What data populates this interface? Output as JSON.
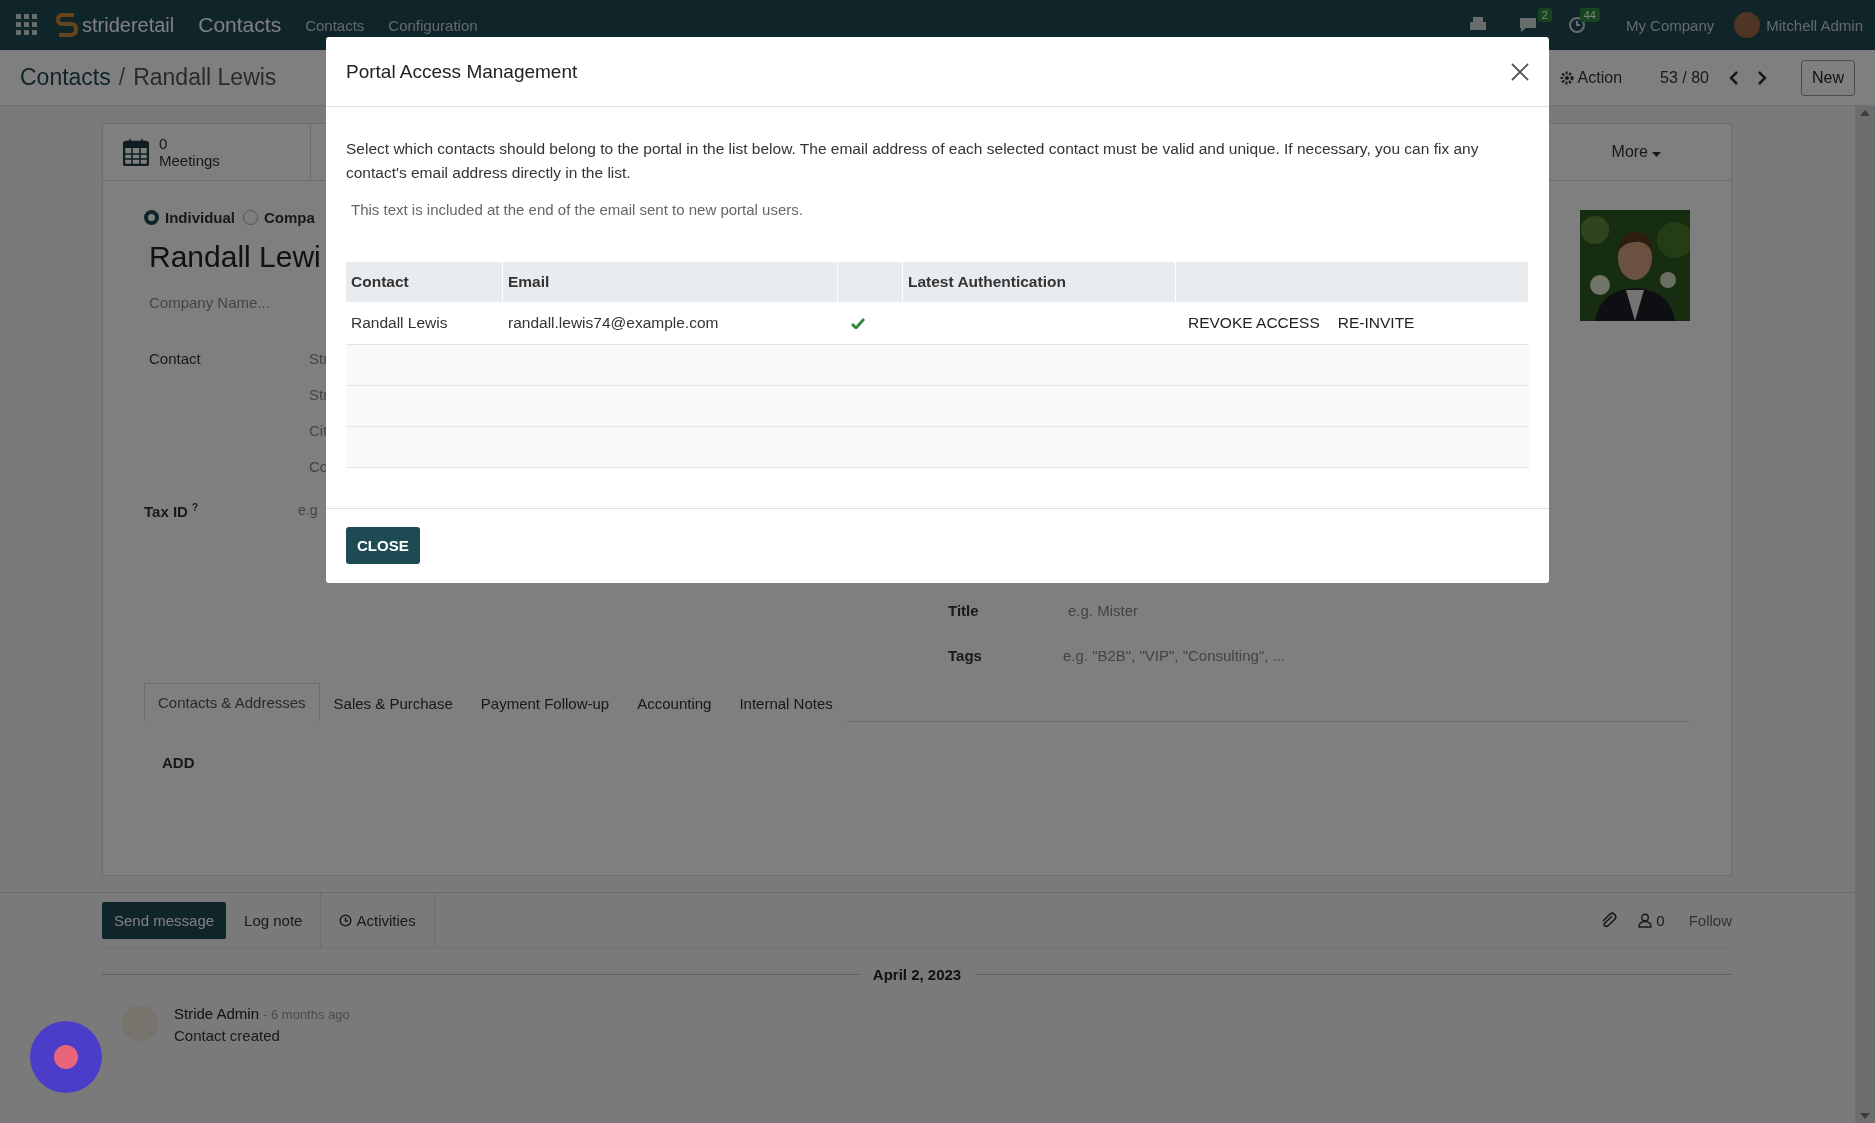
{
  "navbar": {
    "brand": "strideretail",
    "app_title": "Contacts",
    "menu": [
      "Contacts",
      "Configuration"
    ],
    "chat_count": "2",
    "activity_count": "44",
    "company": "My Company",
    "user": "Mitchell Admin"
  },
  "breadcrumb": {
    "parent": "Contacts",
    "separator": "/",
    "current": "Randall Lewis"
  },
  "pager": {
    "action": "Action",
    "position": "53 / 80",
    "new": "New"
  },
  "smart_buttons": [
    {
      "count": "0",
      "label": "Meetings"
    }
  ],
  "more": "More",
  "form": {
    "type_options": [
      {
        "label": "Individual",
        "selected": true
      },
      {
        "label": "Compa",
        "selected": false
      }
    ],
    "name": "Randall Lewi",
    "company": {
      "placeholder": "Company Name..."
    },
    "contact_label": "Contact",
    "address_fields": [
      {
        "placeholder": "Str"
      },
      {
        "placeholder": "Str"
      },
      {
        "placeholder": "Cit"
      },
      {
        "placeholder": "Co"
      }
    ],
    "tax_label": "Tax ID",
    "tax_hint": "?",
    "tax_field": {
      "placeholder": "e.g"
    },
    "title_label": "Title",
    "title_field": {
      "placeholder": "e.g. Mister"
    },
    "tags_label": "Tags",
    "tags_field": {
      "placeholder": "e.g. \"B2B\", \"VIP\", \"Consulting\", ..."
    }
  },
  "tabs": [
    {
      "label": "Contacts & Addresses",
      "selected": true
    },
    {
      "label": "Sales & Purchase",
      "selected": false
    },
    {
      "label": "Payment Follow-up",
      "selected": false
    },
    {
      "label": "Accounting",
      "selected": false
    },
    {
      "label": "Internal Notes",
      "selected": false
    }
  ],
  "add_button": "ADD",
  "chatter": {
    "send": "Send message",
    "log": "Log note",
    "activities": "Activities",
    "followers": "0",
    "follow": "Follow",
    "date": "April 2, 2023",
    "messages": [
      {
        "author": "Stride Admin",
        "time": "- 6 months ago",
        "body": "Contact created"
      }
    ]
  },
  "dialog": {
    "title": "Portal Access Management",
    "intro": "Select which contacts should belong to the portal in the list below. The email address of each selected contact must be valid and unique. If necessary, you can fix any contact's email address directly in the list.",
    "note": "This text is included at the end of the email sent to new portal users.",
    "columns": [
      "Contact",
      "Email",
      "Latest Authentication"
    ],
    "rows": [
      {
        "contact": "Randall Lewis",
        "email": "randall.lewis74@example.com",
        "in_portal": true,
        "actions": [
          "REVOKE ACCESS",
          "RE-INVITE"
        ]
      }
    ],
    "close": "CLOSE"
  }
}
